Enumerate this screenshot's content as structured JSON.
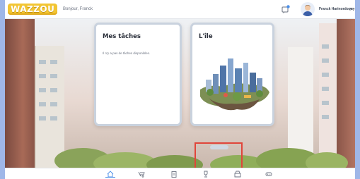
{
  "header": {
    "logo_text": "WAZZOU",
    "greeting": "Bonjour, Franck",
    "username": "Franck Harinordoquy",
    "icons": [
      "chat-notification-icon",
      "avatar",
      "chevron-down-icon"
    ],
    "colors": {
      "logo": "#f2c533",
      "accent": "#4b8fe8"
    }
  },
  "cards": {
    "tasks": {
      "title": "Mes tâches",
      "empty_text": "Il n'y a pas de tâches disponibles."
    },
    "island": {
      "title": "L'île"
    }
  },
  "bottom_nav": {
    "items": [
      {
        "icon": "home-icon",
        "active": true
      },
      {
        "icon": "wheelbarrow-icon",
        "active": false
      },
      {
        "icon": "clipboard-icon",
        "active": false
      },
      {
        "icon": "trophy-icon",
        "active": false
      },
      {
        "icon": "shop-icon",
        "active": false
      },
      {
        "icon": "gamepad-icon",
        "active": false
      }
    ]
  }
}
